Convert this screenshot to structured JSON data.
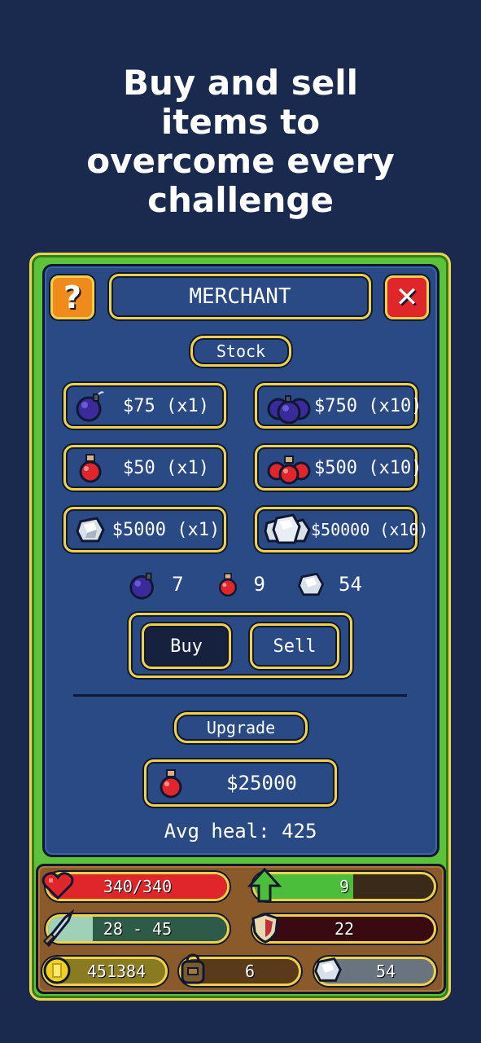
{
  "headline": [
    "Buy and sell",
    "items to",
    "overcome every",
    "challenge"
  ],
  "header": {
    "title": "MERCHANT",
    "help_label": "?",
    "close_label": "✕"
  },
  "stock_label": "Stock",
  "items": [
    {
      "icon": "bomb-icon",
      "label": "$75 (x1)"
    },
    {
      "icon": "bombs-bundle-icon",
      "label": "$750 (x10)"
    },
    {
      "icon": "potion-icon",
      "label": "$50 (x1)"
    },
    {
      "icon": "potions-bundle-icon",
      "label": "$500 (x10)"
    },
    {
      "icon": "gem-icon",
      "label": "$5000 (x1)"
    },
    {
      "icon": "gems-bundle-icon",
      "label": "$50000 (x10)"
    }
  ],
  "inventory": {
    "bombs": "7",
    "potions": "9",
    "gems": "54"
  },
  "modes": {
    "buy": "Buy",
    "sell": "Sell",
    "selected": "buy"
  },
  "upgrade": {
    "label": "Upgrade",
    "price": "$25000",
    "info": "Avg heal: 425"
  },
  "stats": {
    "health": {
      "text": "340/340",
      "level": 1.0
    },
    "level": {
      "text": "9",
      "level": 0.55
    },
    "attack": {
      "text": "28 - 45",
      "level": 0.25
    },
    "defense": {
      "text": "22",
      "level": 0.06
    },
    "gold": "451384",
    "bag": "6",
    "gems": "54"
  },
  "colors": {
    "accent": "#f0d24a",
    "panel": "#2a4a86",
    "health": "#e0262a",
    "xp": "#4cbf3a",
    "attack": "#9fd0b8",
    "defense": "#c0303a"
  }
}
